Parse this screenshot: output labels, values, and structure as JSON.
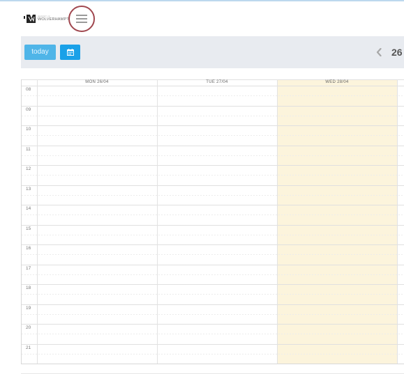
{
  "header": {
    "logo_small": "UNIVERSITY OF",
    "logo_main": "WOLVERHAMPTON",
    "menu_icon": "hamburger-menu-icon"
  },
  "toolbar": {
    "today_label": "today",
    "calendar_icon": "calendar-icon",
    "prev_icon": "chevron-left-icon",
    "range_label": "26"
  },
  "calendar": {
    "days": [
      {
        "label": "MON 26/04",
        "today": false
      },
      {
        "label": "TUE 27/04",
        "today": false
      },
      {
        "label": "WED 28/04",
        "today": true
      }
    ],
    "hours": [
      "08",
      "09",
      "10",
      "11",
      "12",
      "13",
      "14",
      "15",
      "16",
      "17",
      "18",
      "19",
      "20",
      "21"
    ]
  },
  "colors": {
    "today_button": "#4fb5e8",
    "calendar_button": "#1aa1e8",
    "menu_ring": "#a0474f",
    "today_column": "#fcf4dc",
    "toolbar_bg": "#e8ebf0"
  }
}
